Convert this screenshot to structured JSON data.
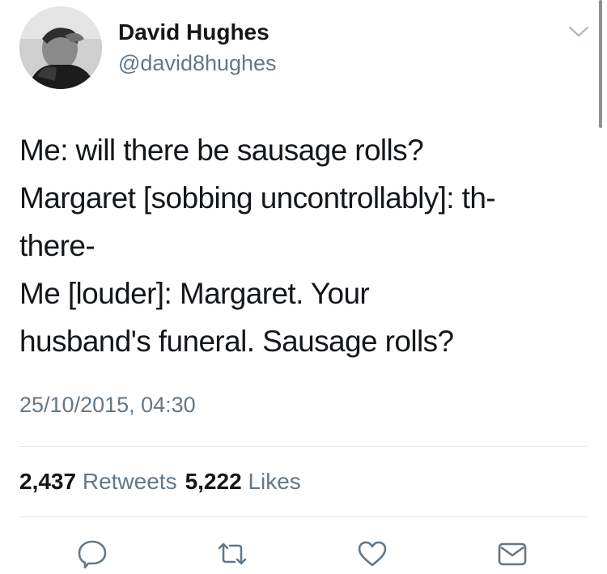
{
  "user": {
    "display_name": "David Hughes",
    "handle": "@david8hughes",
    "avatar_icon": "profile-photo"
  },
  "tweet": {
    "lines": [
      "Me: will there be sausage rolls?",
      "Margaret [sobbing uncontrollably]: th-",
      "there-",
      "Me [louder]: Margaret. Your",
      "husband's funeral. Sausage rolls?"
    ],
    "timestamp": "25/10/2015, 04:30"
  },
  "stats": {
    "retweets_count": "2,437",
    "retweets_label": "Retweets",
    "likes_count": "5,222",
    "likes_label": "Likes"
  },
  "actions": {
    "reply_icon": "reply-icon",
    "retweet_icon": "retweet-icon",
    "like_icon": "heart-icon",
    "dm_icon": "envelope-icon"
  },
  "colors": {
    "text_primary": "#14171a",
    "text_secondary": "#657786",
    "divider": "#e1e8ed",
    "icon": "#657786"
  }
}
